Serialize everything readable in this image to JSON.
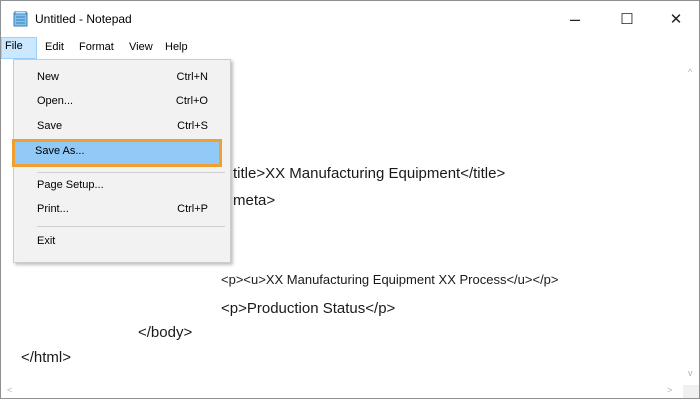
{
  "window": {
    "title": "Untitled - Notepad",
    "icon": "notepad-icon",
    "controls": {
      "minimize": "–",
      "maximize": "☐",
      "close": "✕"
    }
  },
  "menubar": {
    "items": [
      {
        "label": "File"
      },
      {
        "label": "Edit"
      },
      {
        "label": "Format"
      },
      {
        "label": "View"
      },
      {
        "label": "Help"
      }
    ]
  },
  "file_menu": {
    "items": [
      {
        "label": "New",
        "shortcut": "Ctrl+N"
      },
      {
        "label": "Open...",
        "shortcut": "Ctrl+O"
      },
      {
        "label": "Save",
        "shortcut": "Ctrl+S"
      },
      {
        "label": "Save As...",
        "shortcut": ""
      },
      {
        "label": "Page Setup...",
        "shortcut": ""
      },
      {
        "label": "Print...",
        "shortcut": "Ctrl+P"
      },
      {
        "label": "Exit",
        "shortcut": ""
      }
    ],
    "highlight_color": "#f0a030",
    "selected_color": "#91c9f7"
  },
  "editor": {
    "lines": [
      "title>XX Manufacturing Equipment</title>",
      "meta>",
      "<p><u>XX Manufacturing Equipment XX Process</u></p>",
      "<p>Production Status</p>",
      "</body>",
      "</html>"
    ]
  },
  "scrollbars": {
    "up": "^",
    "down": "v",
    "left": "<",
    "right": ">"
  }
}
